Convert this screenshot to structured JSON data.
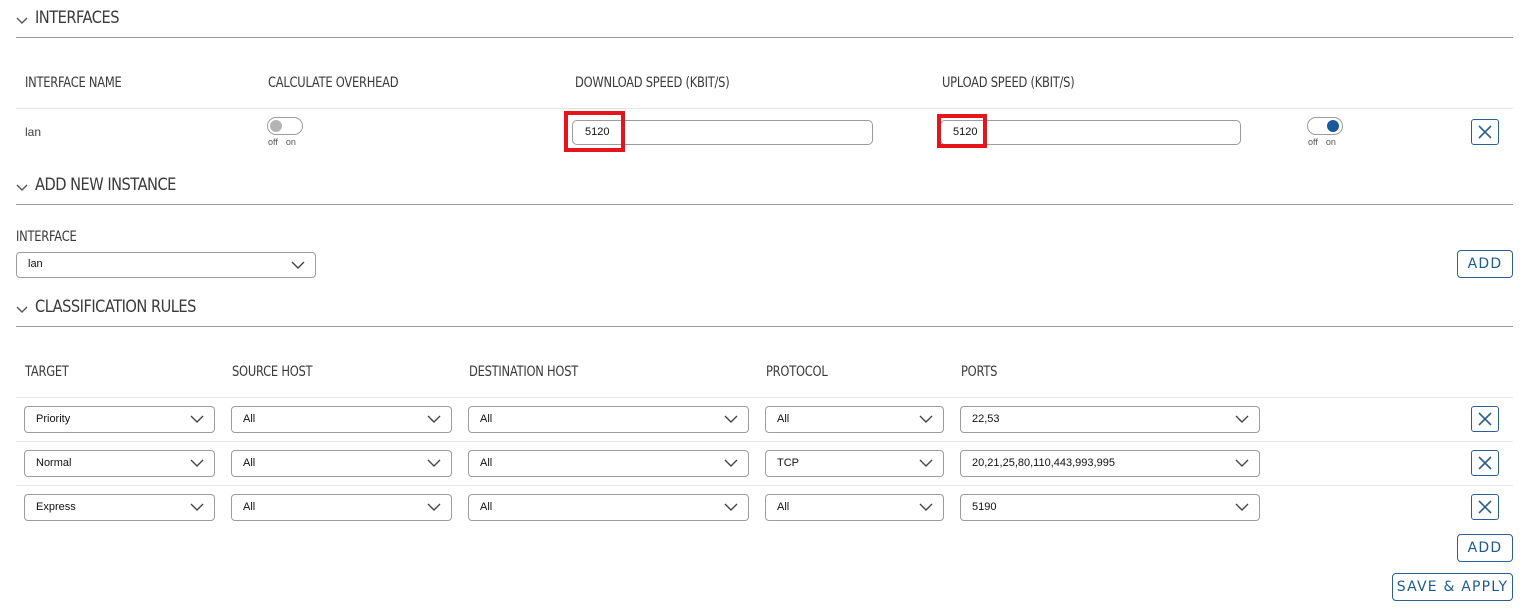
{
  "interfaces": {
    "title": "INTERFACES",
    "columns": {
      "name": "INTERFACE NAME",
      "overhead": "CALCULATE OVERHEAD",
      "download": "DOWNLOAD SPEED (KBIT/S)",
      "upload": "UPLOAD SPEED (KBIT/S)"
    },
    "row": {
      "name": "lan",
      "overhead_enabled": false,
      "download": "5120",
      "upload": "5120",
      "enabled": true,
      "toggle_off": "off",
      "toggle_on": "on"
    }
  },
  "add_instance": {
    "title": "ADD NEW INSTANCE",
    "label": "INTERFACE",
    "selected": "lan",
    "add_label": "ADD"
  },
  "classification": {
    "title": "CLASSIFICATION RULES",
    "columns": {
      "target": "TARGET",
      "source": "SOURCE HOST",
      "destination": "DESTINATION HOST",
      "protocol": "PROTOCOL",
      "ports": "PORTS"
    },
    "rows": [
      {
        "target": "Priority",
        "source": "All",
        "destination": "All",
        "protocol": "All",
        "ports": "22,53"
      },
      {
        "target": "Normal",
        "source": "All",
        "destination": "All",
        "protocol": "TCP",
        "ports": "20,21,25,80,110,443,993,995"
      },
      {
        "target": "Express",
        "source": "All",
        "destination": "All",
        "protocol": "All",
        "ports": "5190"
      }
    ],
    "add_label": "ADD"
  },
  "save_apply_label": "SAVE & APPLY",
  "colors": {
    "accent": "#1f5a8f",
    "toggle_on": "#1a5a9a",
    "toggle_off": "#b4b4b4",
    "highlight": "#e8141c"
  },
  "icons": {
    "collapse": "chevron-down-icon",
    "dropdown": "chevron-down-icon",
    "delete": "close-icon"
  }
}
